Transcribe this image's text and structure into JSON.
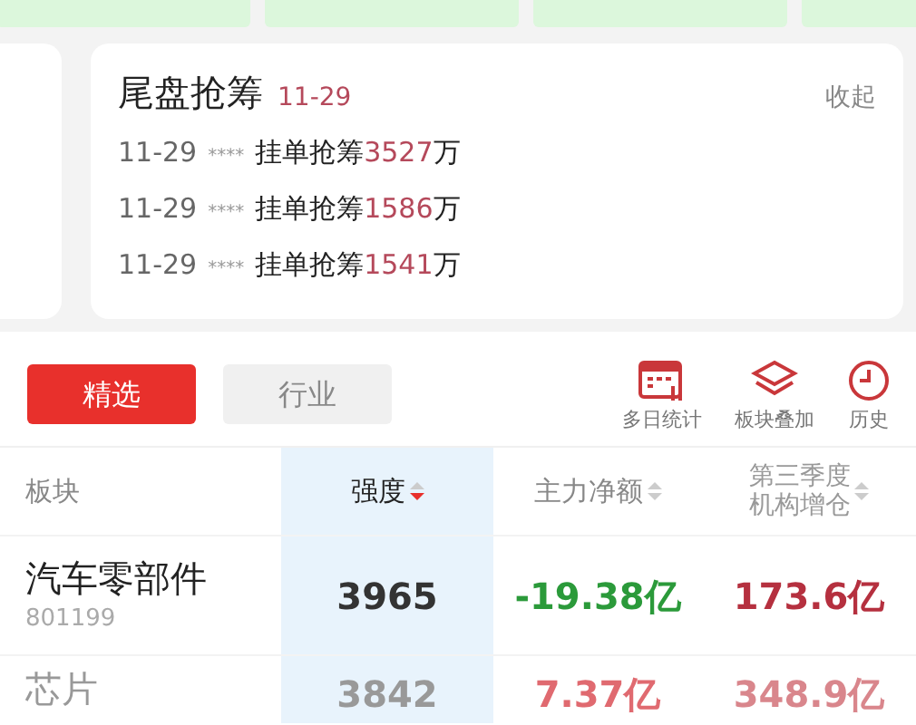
{
  "card": {
    "title": "尾盘抢筹",
    "date": "11-29",
    "collapse": "收起",
    "entries": [
      {
        "date": "11-29",
        "mask": "****",
        "action": "挂单抢筹",
        "amount": "3527",
        "unit": "万"
      },
      {
        "date": "11-29",
        "mask": "****",
        "action": "挂单抢筹",
        "amount": "1586",
        "unit": "万"
      },
      {
        "date": "11-29",
        "mask": "****",
        "action": "挂单抢筹",
        "amount": "1541",
        "unit": "万"
      }
    ]
  },
  "tabs": [
    {
      "label": "精选",
      "selected": true
    },
    {
      "label": "行业",
      "selected": false
    }
  ],
  "tools": [
    {
      "kind": "calendar",
      "label": "多日统计"
    },
    {
      "kind": "layers",
      "label": "板块叠加"
    },
    {
      "kind": "clock",
      "label": "历史"
    }
  ],
  "table": {
    "columns": [
      {
        "lines": [
          "板块"
        ],
        "selected": false
      },
      {
        "lines": [
          "强度"
        ],
        "selected": true,
        "sorted": true
      },
      {
        "lines": [
          "主力净额"
        ],
        "selected": false,
        "sorted": false
      },
      {
        "lines": [
          "第三季度",
          "机构增仓"
        ],
        "selected": false,
        "sorted": false
      }
    ],
    "rows": [
      {
        "name": "汽车零部件",
        "code": "801199",
        "strength": "3965",
        "net": {
          "text": "-19.38亿",
          "color": "#2b9a3a"
        },
        "increase": {
          "text": "173.6亿",
          "color": "#b5303f"
        }
      },
      {
        "name": "芯片",
        "strength": "3842",
        "net": {
          "text": "7.37亿",
          "color": "#e06a70"
        },
        "increase": {
          "text": "348.9亿",
          "color": "#d9868c"
        }
      }
    ]
  }
}
